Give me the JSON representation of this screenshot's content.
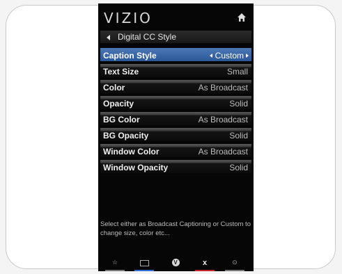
{
  "header": {
    "brand": "VIZIO",
    "menu_title": "Digital CC Style"
  },
  "settings": [
    {
      "label": "Caption Style",
      "value": "Custom",
      "selected": true
    },
    {
      "label": "Text Size",
      "value": "Small"
    },
    {
      "label": "Color",
      "value": "As Broadcast"
    },
    {
      "label": "Opacity",
      "value": "Solid"
    },
    {
      "label": "BG Color",
      "value": "As Broadcast"
    },
    {
      "label": "BG Opacity",
      "value": "Solid"
    },
    {
      "label": "Window Color",
      "value": "As Broadcast"
    },
    {
      "label": "Window Opacity",
      "value": "Solid"
    }
  ],
  "description": "Select either as Broadcast Captioning or Custom to change size, color etc...",
  "footer": {
    "items": [
      {
        "icon": "star-icon",
        "color": "#444444"
      },
      {
        "icon": "input-box-icon",
        "color": "#2f6fd1"
      },
      {
        "icon": "v-logo-icon",
        "label": "V"
      },
      {
        "icon": "close-icon",
        "label": "x",
        "color": "#c8242c"
      },
      {
        "icon": "dot-icon",
        "color": "#7a7a7a"
      }
    ]
  },
  "colors": {
    "selection": "#3b67a8",
    "screen_background": "#060606"
  }
}
